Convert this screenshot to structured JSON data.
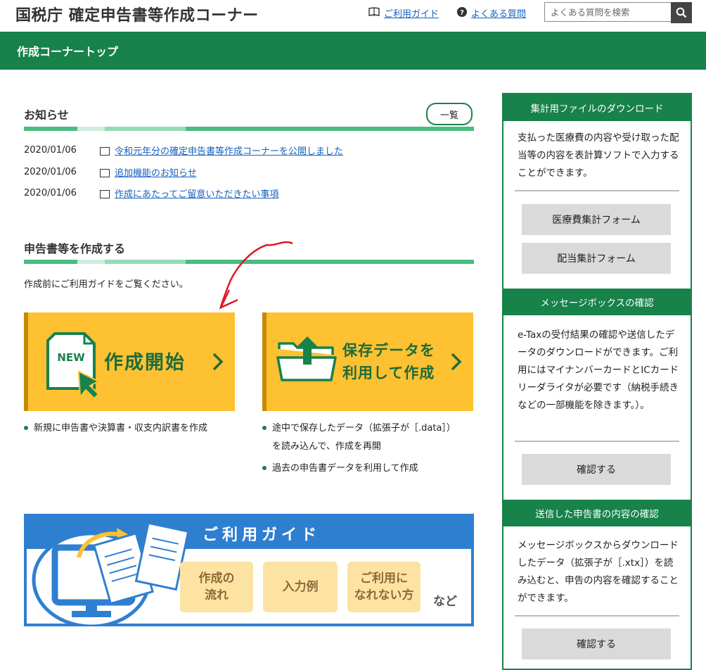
{
  "header": {
    "title": "国税庁 確定申告書等作成コーナー",
    "guide_link": "ご利用ガイド",
    "faq_link": "よくある質問",
    "search_placeholder": "よくある質問を検索"
  },
  "nav": {
    "current": "作成コーナートップ"
  },
  "news": {
    "heading": "お知らせ",
    "list_button": "一覧",
    "items": [
      {
        "date": "2020/01/06",
        "title": "令和元年分の確定申告書等作成コーナーを公開しました"
      },
      {
        "date": "2020/01/06",
        "title": "追加機能のお知らせ"
      },
      {
        "date": "2020/01/06",
        "title": "作成にあたってご留意いただきたい事項"
      }
    ]
  },
  "create": {
    "heading": "申告書等を作成する",
    "lead": "作成前にご利用ガイドをご覧ください。",
    "start": {
      "label": "作成開始",
      "badge": "NEW",
      "bullets": [
        "新規に申告書や決算書・収支内訳書を作成"
      ]
    },
    "saved": {
      "label_line1": "保存データを",
      "label_line2": "利用して作成",
      "bullets_1a": "途中で保存したデータ（拡張子が［.data］）",
      "bullets_1b": "を読み込んで、作成を再開",
      "bullets_2": "過去の申告書データを利用して作成"
    }
  },
  "guide": {
    "title": "ご利用ガイド",
    "chips": [
      {
        "line1": "作成の",
        "line2": "流れ"
      },
      {
        "line1": "入力例",
        "line2": ""
      },
      {
        "line1": "ご利用に",
        "line2": "なれない方"
      }
    ],
    "suffix": "など"
  },
  "sidebar": {
    "sections": [
      {
        "heading": "集計用ファイルのダウンロード",
        "text": "支払った医療費の内容や受け取った配当等の内容を表計算ソフトで入力することができます。",
        "buttons": [
          "医療費集計フォーム",
          "配当集計フォーム"
        ]
      },
      {
        "heading": "メッセージボックスの確認",
        "text": "e-Taxの受付結果の確認や送信したデータのダウンロードができます。ご利用にはマイナンバーカードとICカードリーダライタが必要です（納税手続きなどの一部機能を除きます。）。",
        "buttons": [
          "確認する"
        ]
      },
      {
        "heading": "送信した申告書の内容の確認",
        "text": "メッセージボックスからダウンロードしたデータ（拡張子が［.xtx］）を読み込むと、申告の内容を確認することができます。",
        "buttons": [
          "確認する"
        ]
      }
    ]
  },
  "colors": {
    "brand_green": "#17824a",
    "button_yellow": "#fdc131",
    "guide_blue": "#2f7fd1",
    "link_blue": "#1560bd",
    "annotation_red": "#e0182b"
  }
}
